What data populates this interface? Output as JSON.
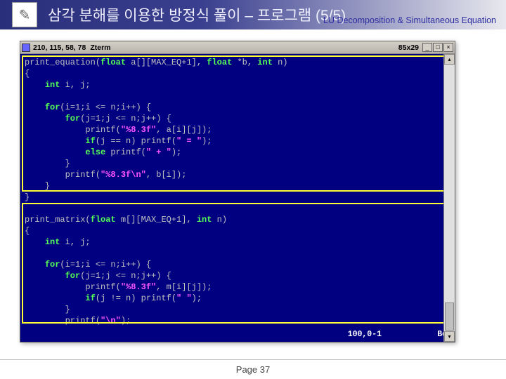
{
  "header": {
    "title": "삼각 분해를 이용한 방정식 풀이 – 프로그램 (5/5)",
    "subtitle": "LU Decomposition &  Simultaneous Equation"
  },
  "terminal": {
    "coords": "210, 115, 58, 78",
    "app": "Zterm",
    "dims": "85x29",
    "status_pos": "100,0-1",
    "status_side": "Bot",
    "win_min": "_",
    "win_max": "□",
    "win_close": "×",
    "scroll_up": "▴",
    "scroll_down": "▾"
  },
  "code": {
    "fn1_sig_a": "print_equation(",
    "fn1_sig_b": " a[][MAX_EQ+1], ",
    "fn1_sig_c": " *b, ",
    "fn1_sig_d": " n)",
    "brace_open": "{",
    "decl_int": "int",
    "decl_ij": " i, j;",
    "for_kw": "for",
    "for1_outer": "(i=1;i <= n;i++) {",
    "for1_inner": "(j=1;j <= n;j++) {",
    "printf1": "            printf(",
    "fmt83f": "\"%8.3f\"",
    "arg_aij": ", a[i][j]);",
    "if_kw": "if",
    "if_cond": "(j == n) printf(",
    "str_eq": "\" = \"",
    "close_paren": ");",
    "else_kw": "else",
    "else_body": " printf(",
    "str_plus": "\" + \"",
    "brace_close_inner": "        }",
    "printf_b": "        printf(",
    "fmt83fn": "\"%8.3f\\n\"",
    "arg_bi": ", b[i]);",
    "brace_close_outer": "    }",
    "brace_close_fn": "}",
    "fn2_sig_a": "print_matrix(",
    "fn2_sig_b": " m[][MAX_EQ+1], ",
    "fn2_sig_c": " n)",
    "for2_outer": "(i=1;i <= n;i++) {",
    "for2_inner": "(j=1;j <= n;j++) {",
    "arg_mij": ", m[i][j]);",
    "if2_cond": "(j != n) printf(",
    "str_space": "\" \"",
    "printf_nl": "        printf(",
    "str_nl": "\"\\n\"",
    "float_kw": "float",
    "int_kw": "int"
  },
  "footer": {
    "page": "Page 37"
  }
}
